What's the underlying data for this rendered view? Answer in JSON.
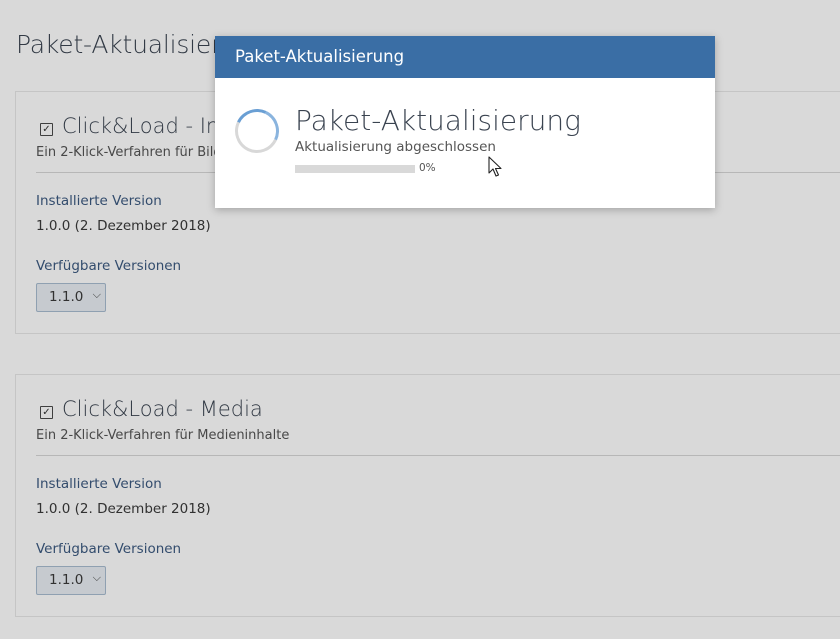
{
  "page": {
    "title": "Paket-Aktualisierung"
  },
  "packages": [
    {
      "title": "Click&Load - Images",
      "description": "Ein 2-Klick-Verfahren für Bilder",
      "installed_label": "Installierte Version",
      "installed_value": "1.0.0 (2. Dezember 2018)",
      "available_label": "Verfügbare Versionen",
      "selected_version": "1.1.0",
      "checked": true
    },
    {
      "title": "Click&Load - Media",
      "description": "Ein 2-Klick-Verfahren für Medieninhalte",
      "installed_label": "Installierte Version",
      "installed_value": "1.0.0 (2. Dezember 2018)",
      "available_label": "Verfügbare Versionen",
      "selected_version": "1.1.0",
      "checked": true
    }
  ],
  "dialog": {
    "title": "Paket-Aktualisierung",
    "heading": "Paket-Aktualisierung",
    "status": "Aktualisierung abgeschlossen",
    "progress_text": "0%",
    "progress_fraction": 0,
    "colors": {
      "header": "#3a6ea5",
      "spinner_accent": "#6a9fd4"
    }
  },
  "icons": {
    "checkbox": "checkbox-checked-icon",
    "chevron": "chevron-down-icon",
    "spinner": "loading-spinner-icon",
    "cursor": "mouse-pointer-icon"
  }
}
